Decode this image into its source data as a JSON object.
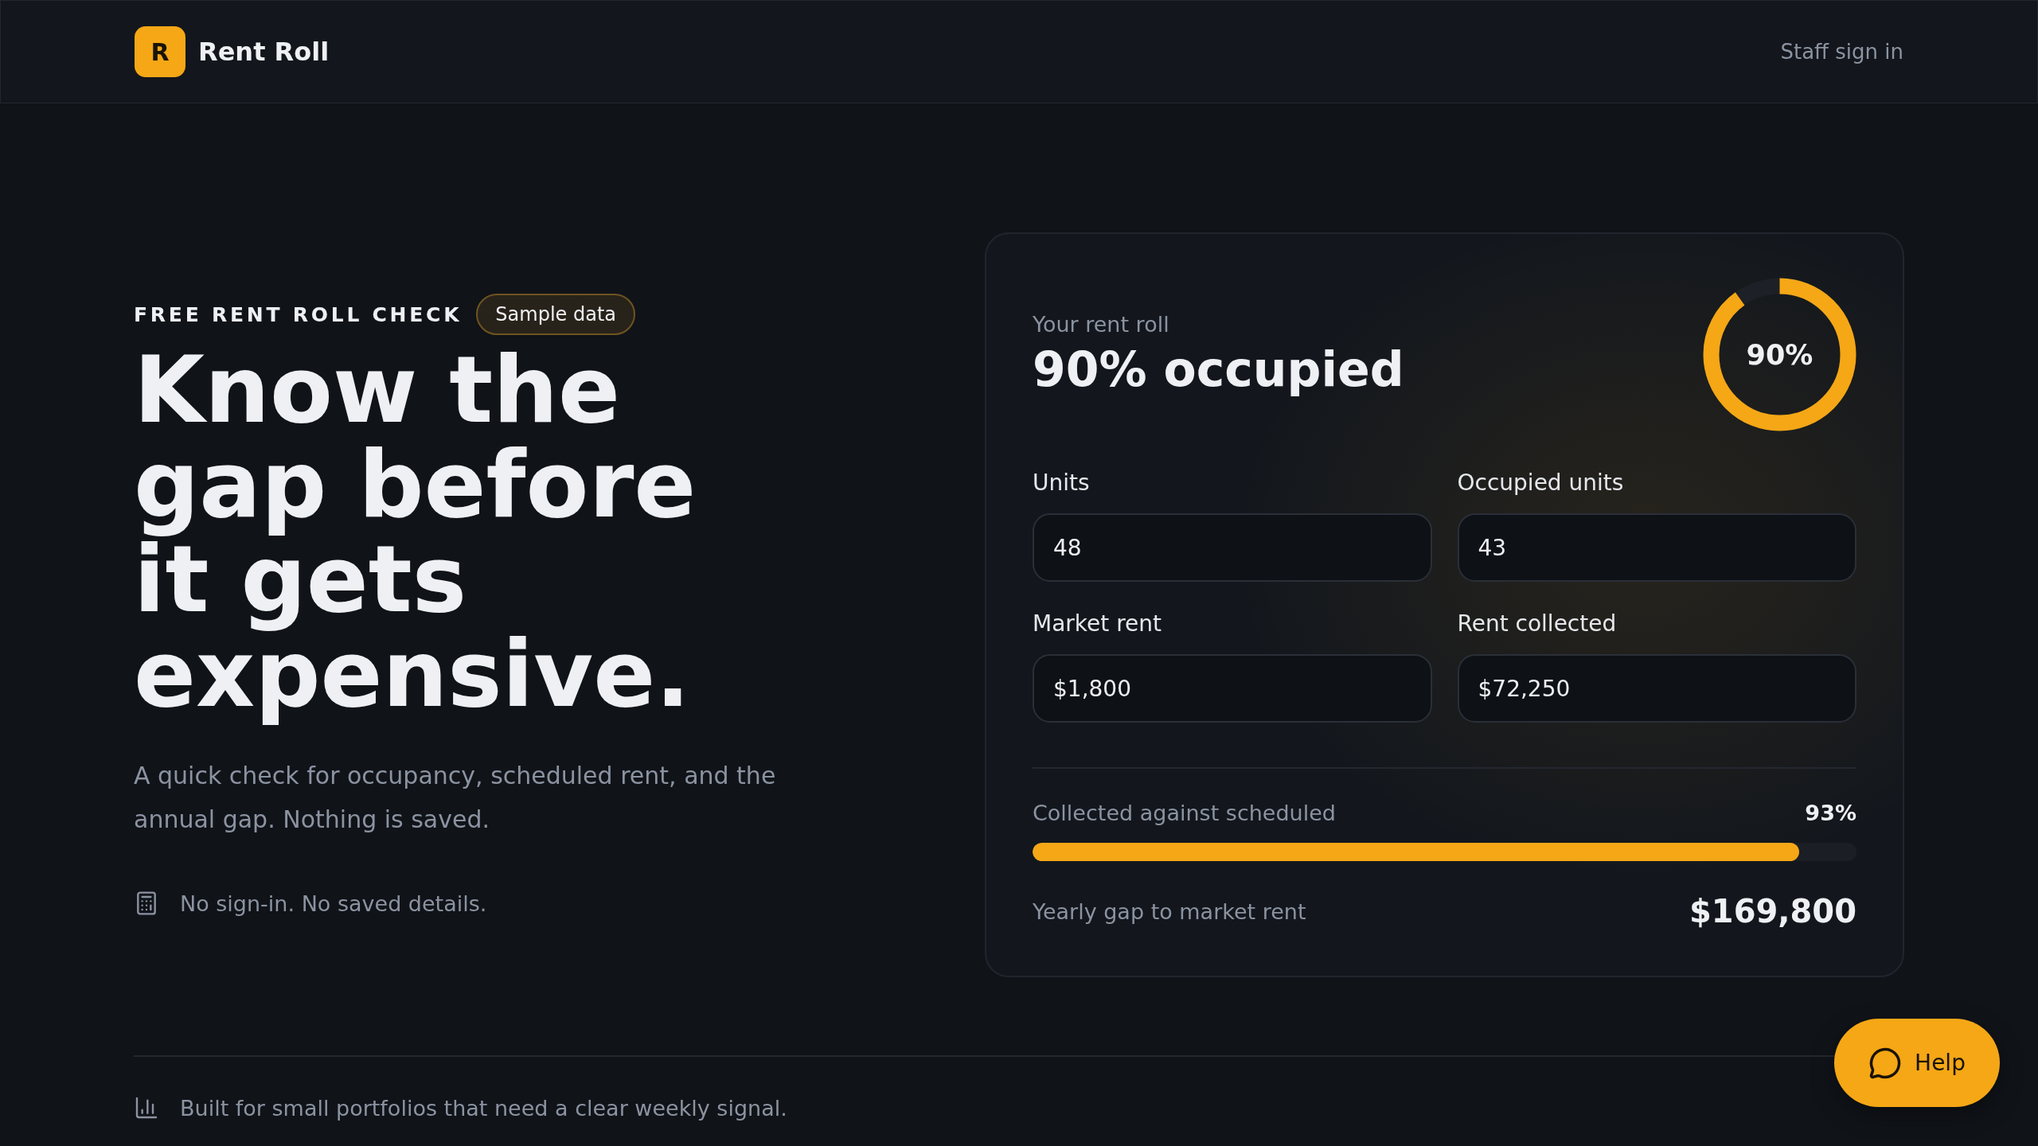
{
  "header": {
    "logo_letter": "R",
    "brand": "Rent Roll",
    "nav_link": "Staff sign in"
  },
  "hero": {
    "eyebrow": "FREE RENT ROLL CHECK",
    "badge": "Sample data",
    "heading": "Know the gap before it gets expensive.",
    "subtitle": "A quick check for occupancy, scheduled rent, and the annual gap. Nothing is saved.",
    "note": "No sign-in. No saved details."
  },
  "card": {
    "kicker": "Your rent roll",
    "headline": "90% occupied",
    "ring": {
      "label": "90%",
      "level": 0.9
    },
    "fields": [
      {
        "label": "Units",
        "value": "48"
      },
      {
        "label": "Occupied units",
        "value": "43"
      },
      {
        "label": "Market rent",
        "value": "$1,800"
      },
      {
        "label": "Rent collected",
        "value": "$72,250"
      }
    ],
    "progress": {
      "label": "Collected against scheduled",
      "reading": "93%",
      "level": 0.93
    },
    "gap": {
      "label": "Yearly gap to market rent",
      "value": "$169,800"
    }
  },
  "footer": {
    "note": "Built for small portfolios that need a clear weekly signal."
  },
  "help_button": {
    "label": "Help"
  }
}
